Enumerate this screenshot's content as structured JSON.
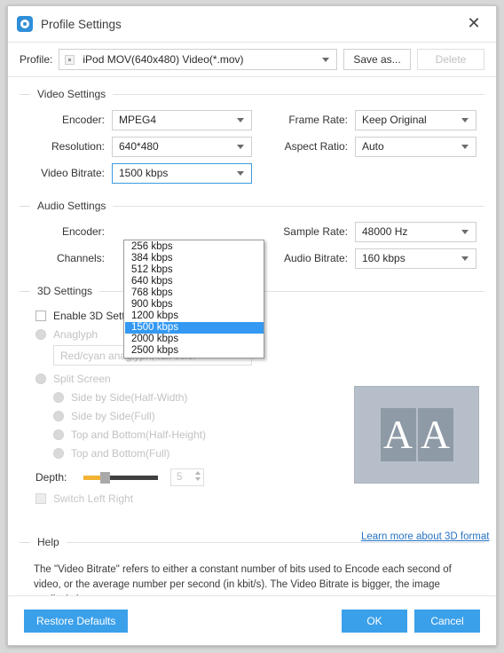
{
  "window": {
    "title": "Profile Settings",
    "app_icon": "film-reel-icon",
    "close_icon": "close-icon"
  },
  "profile_bar": {
    "label": "Profile:",
    "value": "iPod MOV(640x480) Video(*.mov)",
    "save_as_label": "Save as...",
    "delete_label": "Delete"
  },
  "video_settings": {
    "group_title": "Video Settings",
    "encoder": {
      "label": "Encoder:",
      "value": "MPEG4"
    },
    "resolution": {
      "label": "Resolution:",
      "value": "640*480"
    },
    "video_bitrate": {
      "label": "Video Bitrate:",
      "value": "1500 kbps"
    },
    "frame_rate": {
      "label": "Frame Rate:",
      "value": "Keep Original"
    },
    "aspect_ratio": {
      "label": "Aspect Ratio:",
      "value": "Auto"
    }
  },
  "bitrate_dropdown": {
    "selected": "1500 kbps",
    "options": [
      "256 kbps",
      "384 kbps",
      "512 kbps",
      "640 kbps",
      "768 kbps",
      "900 kbps",
      "1200 kbps",
      "1500 kbps",
      "2000 kbps",
      "2500 kbps"
    ]
  },
  "audio_settings": {
    "group_title": "Audio Settings",
    "encoder": {
      "label": "Encoder:",
      "value": ""
    },
    "channels": {
      "label": "Channels:",
      "value": ""
    },
    "sample_rate": {
      "label": "Sample Rate:",
      "value": "48000 Hz"
    },
    "audio_bitrate": {
      "label": "Audio Bitrate:",
      "value": "160 kbps"
    }
  },
  "three_d_settings": {
    "group_title": "3D Settings",
    "enable_label": "Enable 3D Settings",
    "anaglyph_label": "Anaglyph",
    "anaglyph_value": "Red/cyan anaglyph, full color",
    "split_screen_label": "Split Screen",
    "split_options": [
      "Side by Side(Half-Width)",
      "Side by Side(Full)",
      "Top and Bottom(Half-Height)",
      "Top and Bottom(Full)"
    ],
    "depth_label": "Depth:",
    "depth_value": "5",
    "switch_left_right_label": "Switch Left Right",
    "learn_more_label": "Learn more about 3D format",
    "preview_glyph_left": "A",
    "preview_glyph_right": "A"
  },
  "help": {
    "group_title": "Help",
    "text": "The \"Video Bitrate\" refers to either a constant number of bits used to Encode each second of video, or the average number per second (in kbit/s). The Video Bitrate is bigger, the image quality is better."
  },
  "footer": {
    "restore_defaults_label": "Restore Defaults",
    "ok_label": "OK",
    "cancel_label": "Cancel"
  },
  "colors": {
    "accent_blue": "#3ba0ea",
    "highlight_blue": "#3399f2",
    "link_blue": "#2673c4",
    "slider_fill": "#f2b233"
  }
}
